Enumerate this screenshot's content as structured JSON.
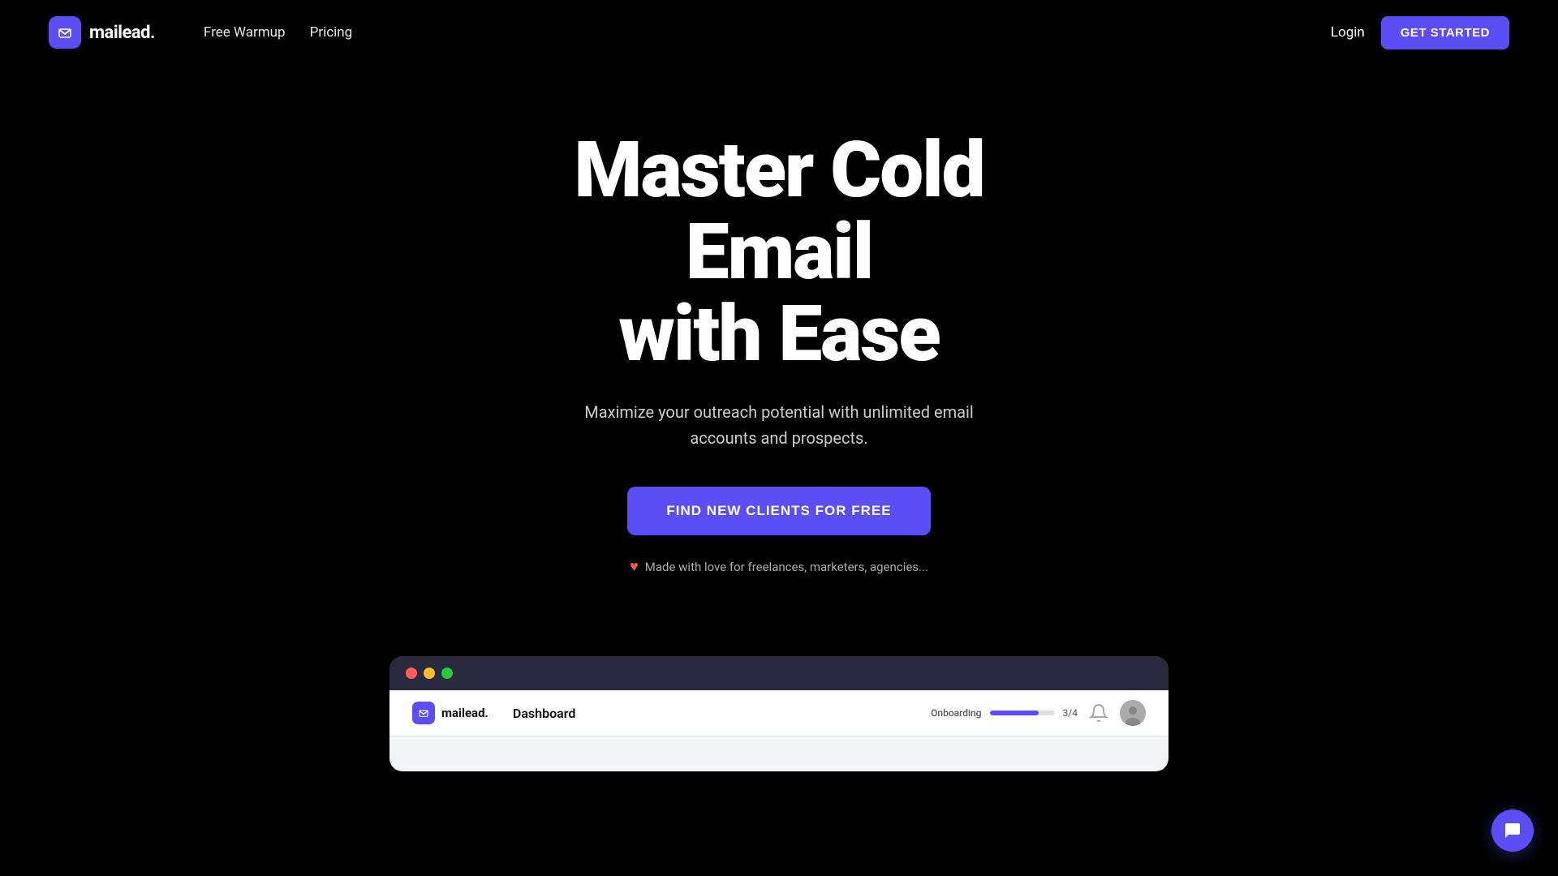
{
  "brand": {
    "name": "mailead.",
    "logo_alt": "mailead logo"
  },
  "nav": {
    "links": [
      {
        "label": "Free Warmup",
        "id": "free-warmup"
      },
      {
        "label": "Pricing",
        "id": "pricing"
      }
    ],
    "login_label": "Login",
    "get_started_label": "GET STARTED"
  },
  "hero": {
    "title_line1": "Master Cold",
    "title_line2": "Email",
    "title_line3": "with Ease",
    "subtitle": "Maximize your outreach potential with unlimited email accounts and prospects.",
    "cta_label": "FIND NEW CLIENTS FOR FREE",
    "tagline": "Made with love for freelances, marketers, agencies..."
  },
  "dashboard_preview": {
    "nav_label": "Dashboard",
    "onboarding_label": "Onboarding",
    "onboarding_count": "3/4",
    "onboarding_progress_pct": 75
  },
  "colors": {
    "accent": "#5b4ef5",
    "background": "#000000",
    "heart": "#e8633a"
  }
}
